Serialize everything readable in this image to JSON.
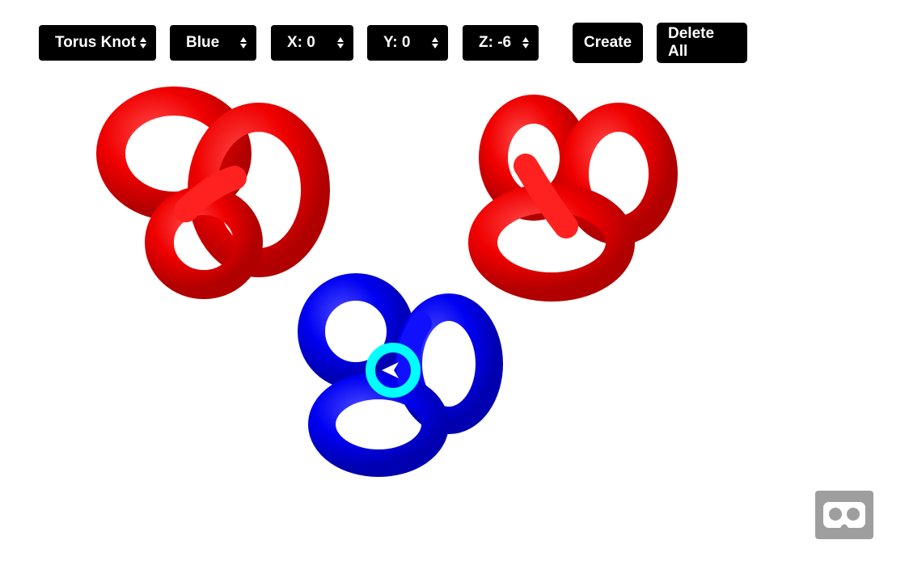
{
  "toolbar": {
    "shape_select": {
      "value": "Torus Knot"
    },
    "color_select": {
      "value": "Blue"
    },
    "x_select": {
      "value": "X: 0"
    },
    "y_select": {
      "value": "Y: 0"
    },
    "z_select": {
      "value": "Z: -6"
    },
    "create_label": "Create",
    "delete_label": "Delete All"
  },
  "scene": {
    "objects": [
      {
        "shape": "torus-knot",
        "color": "#ff0000"
      },
      {
        "shape": "torus-knot",
        "color": "#ff0000"
      },
      {
        "shape": "torus-knot",
        "color": "#0000ff"
      }
    ],
    "cursor_color": "#00ffff"
  },
  "vr_button": {
    "icon": "vr-headset-icon"
  }
}
